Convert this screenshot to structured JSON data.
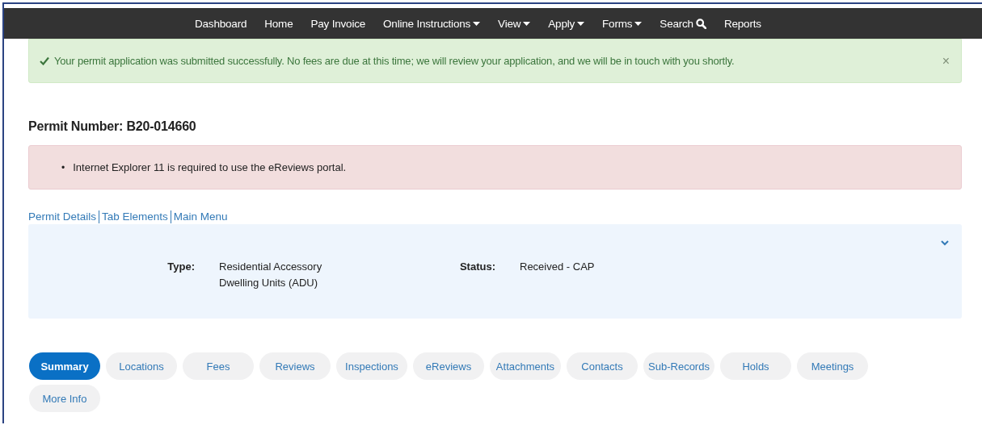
{
  "nav": {
    "items": [
      {
        "label": "Dashboard",
        "kind": "link"
      },
      {
        "label": "Home",
        "kind": "link"
      },
      {
        "label": "Pay Invoice",
        "kind": "link"
      },
      {
        "label": "Online Instructions",
        "kind": "dropdown"
      },
      {
        "label": "View",
        "kind": "dropdown"
      },
      {
        "label": "Apply",
        "kind": "dropdown"
      },
      {
        "label": "Forms",
        "kind": "dropdown"
      },
      {
        "label": "Search",
        "kind": "search"
      },
      {
        "label": "Reports",
        "kind": "link"
      }
    ]
  },
  "success_alert": {
    "message": "Your permit application was submitted successfully. No fees are due at this time; we will review your application, and we will be in touch with you shortly.",
    "close": "×"
  },
  "permit_number": "Permit Number: B20-014660",
  "error_alert": {
    "items": [
      {
        "bullet": "•",
        "text": "Internet Explorer 11 is required to use the eReviews portal."
      }
    ]
  },
  "links": [
    "Permit Details",
    "Tab Elements",
    "Main Menu"
  ],
  "details": {
    "fields": [
      {
        "label": "Type:",
        "value": "Residential Accessory Dwelling Units (ADU)"
      },
      {
        "label": "Status:",
        "value": "Received - CAP"
      }
    ]
  },
  "tabs": [
    {
      "label": "Summary",
      "selected": true
    },
    {
      "label": "Locations",
      "selected": false
    },
    {
      "label": "Fees",
      "selected": false
    },
    {
      "label": "Reviews",
      "selected": false
    },
    {
      "label": "Inspections",
      "selected": false
    },
    {
      "label": "eReviews",
      "selected": false
    },
    {
      "label": "Attachments",
      "selected": false
    },
    {
      "label": "Contacts",
      "selected": false
    },
    {
      "label": "Sub-Records",
      "selected": false
    },
    {
      "label": "Holds",
      "selected": false
    },
    {
      "label": "Meetings",
      "selected": false
    },
    {
      "label": "More Info",
      "selected": false
    }
  ]
}
